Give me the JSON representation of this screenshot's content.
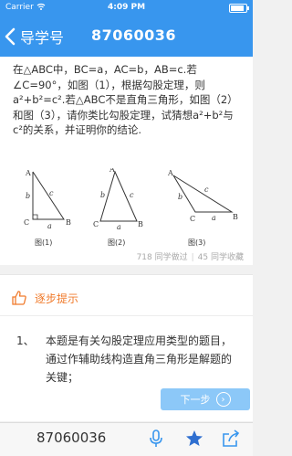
{
  "status": {
    "carrier": "Carrier",
    "time": "4:09 PM"
  },
  "nav": {
    "back_label": "导学号",
    "title": "87060036"
  },
  "question": {
    "text": "在△ABC中，BC=a，AC=b，AB=c.若∠C=90°，如图（1），根据勾股定理，则a²+b²=c².若△ABC不是直角三角形，如图（2）和图（3），请你类比勾股定理，试猜想a²+b²与c²的关系，并证明你的结论.",
    "fig1_label": "图(1)",
    "fig2_label": "图(2)",
    "fig3_label": "图(3)",
    "pt_A": "A",
    "pt_B": "B",
    "pt_C": "C",
    "side_a": "a",
    "side_b": "b",
    "side_c": "c",
    "stats_practiced": "718 同学做过",
    "stats_favorited": "45 同学收藏"
  },
  "hint": {
    "title": "逐步提示",
    "number": "1、",
    "text": "本题是有关勾股定理应用类型的题目，通过作辅助线构造直角三角形是解题的关键；",
    "next_label": "下一步"
  },
  "bottom": {
    "code": "87060036",
    "icons": [
      "microphone-icon",
      "star-icon",
      "share-icon"
    ]
  },
  "colors": {
    "primary": "#3896ee",
    "accent": "#f07b2c",
    "button": "#8cc8f8"
  }
}
